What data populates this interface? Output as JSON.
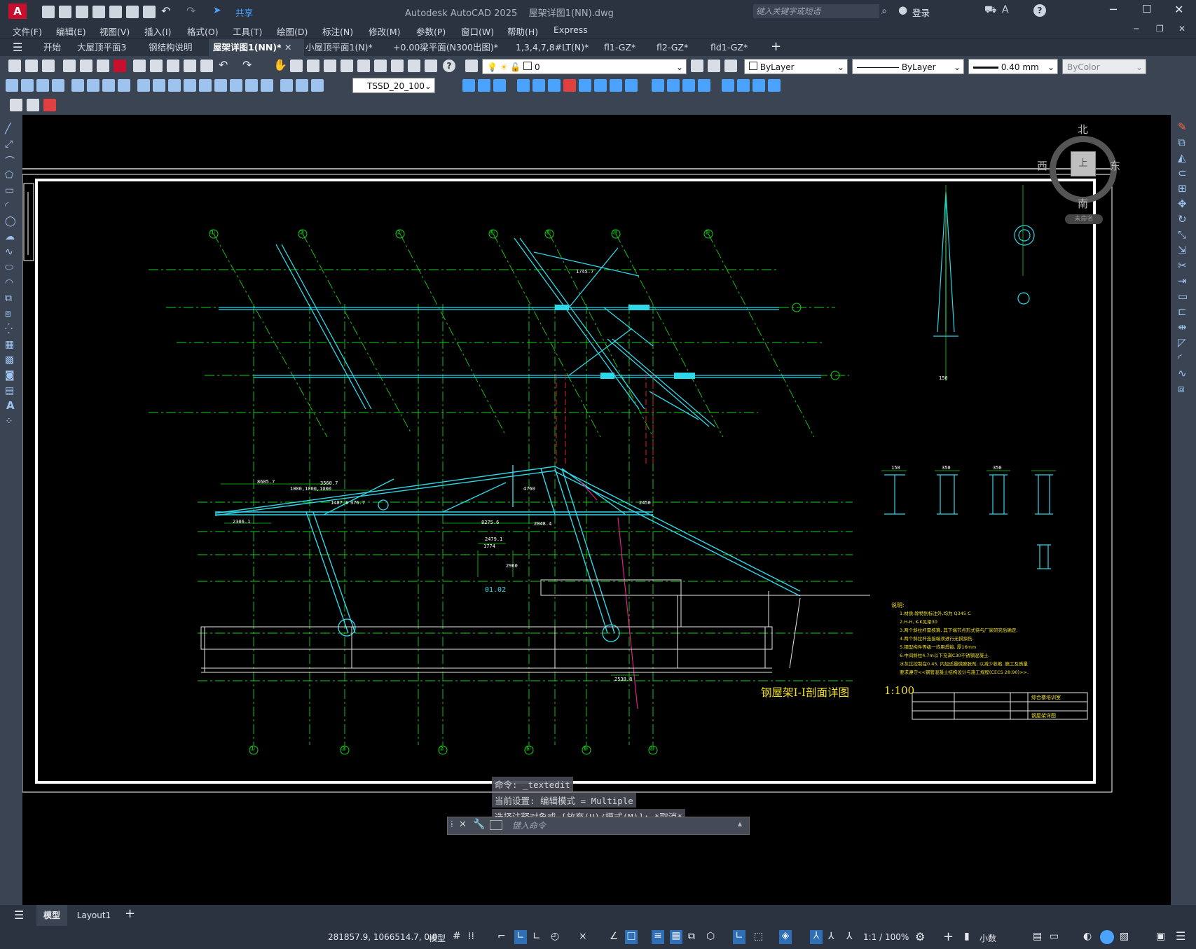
{
  "window": {
    "app_title": "Autodesk AutoCAD 2025",
    "document_title": "屋架详图1(NN).dwg",
    "share_label": "共享",
    "search_placeholder": "键入关键字或短语",
    "login_label": "登录"
  },
  "menu": [
    "文件(F)",
    "编辑(E)",
    "视图(V)",
    "插入(I)",
    "格式(O)",
    "工具(T)",
    "绘图(D)",
    "标注(N)",
    "修改(M)",
    "参数(P)",
    "窗口(W)",
    "帮助(H)",
    "Express"
  ],
  "doc_tabs": [
    {
      "label": "开始",
      "active": false
    },
    {
      "label": "大屋顶平面3",
      "active": false
    },
    {
      "label": "钢结构说明",
      "active": false
    },
    {
      "label": "屋架详图1(NN)*",
      "active": true
    },
    {
      "label": "小屋顶平面1(N)*",
      "active": false
    },
    {
      "label": "+0.00梁平面(N300出图)*",
      "active": false
    },
    {
      "label": "1,3,4,7,8#LT(N)*",
      "active": false
    },
    {
      "label": "fl1-GZ*",
      "active": false
    },
    {
      "label": "fl2-GZ*",
      "active": false
    },
    {
      "label": "fld1-GZ*",
      "active": false
    }
  ],
  "properties": {
    "layer_value": "0",
    "color": "ByLayer",
    "linetype": "ByLayer",
    "lineweight": "0.40 mm",
    "plotstyle": "ByColor",
    "dimstyle": "TSSD_20_100"
  },
  "viewcube": {
    "north": "北",
    "south": "南",
    "east": "东",
    "west": "西",
    "top": "上",
    "ucs": "未命名"
  },
  "drawing": {
    "title": "钢屋架I-I剖面详图",
    "scale": "1:100",
    "axis_labels_top": [
      "①",
      "③",
      "②",
      "⑥",
      "⑧",
      "⑩",
      "⑨"
    ],
    "axis_labels_bottom": [
      "①",
      "③",
      "②",
      "⑥",
      "⑧",
      "⑩"
    ],
    "dims": [
      "8685.7",
      "3560.7",
      "1000,1000,1000",
      "1487.6",
      "376.7",
      "2306.1",
      "8275.6",
      "2048.4",
      "2479.1",
      "1774",
      "2450",
      "2538.8",
      "1745.7",
      "4760",
      "2960"
    ],
    "section_ref": "01.02",
    "notes_title": "说明:",
    "notes": [
      "1.材质:除特别标注外,均为 Q345 C",
      "2.H-H, K-K见梁30",
      "3.两个斜拉杆需核算, 其下端节点形式待与厂家研究后确定.",
      "4.两个斜拉杆连接端须进行无损探伤.",
      "5.钢型构件等级一均用焊接, 厚16mm",
      "6.中间斜柱4.7m以下充满C30不锈钢混凝土.",
      "水灰比控制在0.45, 内加适量微膨胀剂, 以减少收缩, 施工及质量",
      "要求遵守<<钢管混凝土结构设计与施工规程(CECS 28:90)>>."
    ],
    "title_block": {
      "project": "综合楼培训室",
      "sheet": "钢屋架详图"
    },
    "section_dims": [
      "150",
      "350",
      "350",
      "150"
    ]
  },
  "command": {
    "history": [
      "命令: _textedit",
      "当前设置: 编辑模式 = Multiple",
      "选择注释对象或 [放弃(U)/模式(M)]: *取消*"
    ],
    "placeholder": "键入命令"
  },
  "layout_tabs": [
    {
      "label": "模型",
      "active": true
    },
    {
      "label": "Layout1",
      "active": false
    }
  ],
  "status": {
    "coords": "281857.9, 1066514.7, 0.0",
    "space": "模型",
    "annotation_scale": "1:1 / 100%",
    "units": "小数"
  }
}
